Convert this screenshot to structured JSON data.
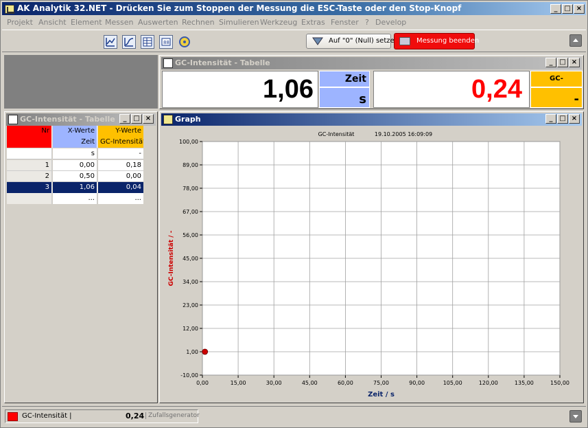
{
  "window": {
    "title": "AK Analytik 32.NET - Drücken Sie zum Stoppen der Messung die ESC-Taste oder den Stop-Knopf"
  },
  "menu": [
    "Projekt",
    "Ansicht",
    "Element",
    "Messen",
    "Auswerten",
    "Rechnen",
    "Simulieren",
    "Werkzeug",
    "Extras",
    "Fenster",
    "?",
    "Develop"
  ],
  "toolbar": {
    "zero_button": "Auf \"0\" (Null) setzen",
    "stop_button": "Messung beenden"
  },
  "value_panel": {
    "title": "GC-Intensität - Tabelle",
    "time_value": "1,06",
    "time_label": "Zeit",
    "time_unit": "s",
    "intensity_value": "0,24",
    "intensity_label": "GC-Intensität",
    "intensity_unit": "-"
  },
  "table_panel": {
    "title": "GC-Intensität - Tabelle",
    "headers": [
      "Nr",
      "X-Werte",
      "Y-Werte"
    ],
    "names": [
      "",
      "Zeit",
      "GC-Intensität"
    ],
    "units": [
      "",
      "s",
      "-"
    ],
    "rows": [
      [
        "1",
        "0,00",
        "0,18"
      ],
      [
        "2",
        "0,50",
        "0,00"
      ],
      [
        "3",
        "1,06",
        "0,04"
      ]
    ],
    "ellipsis": "..."
  },
  "graph_panel": {
    "title": "Graph"
  },
  "chart_data": {
    "type": "scatter",
    "title": "GC-Intensität",
    "timestamp": "19.10.2005 16:09:09",
    "xlabel": "Zeit / s",
    "ylabel": "GC-Intensität / -",
    "xlim": [
      0,
      150
    ],
    "ylim": [
      -10,
      100
    ],
    "x_ticks": [
      "0,00",
      "15,00",
      "30,00",
      "45,00",
      "60,00",
      "75,00",
      "90,00",
      "105,00",
      "120,00",
      "135,00",
      "150,00"
    ],
    "y_ticks": [
      "-10,00",
      "1,00",
      "12,00",
      "23,00",
      "34,00",
      "45,00",
      "56,00",
      "67,00",
      "78,00",
      "89,00",
      "100,00"
    ],
    "grid": true,
    "series": [
      {
        "points": [
          [
            1.06,
            1.0
          ]
        ],
        "color": "#cc0000"
      }
    ]
  },
  "status": {
    "channel": "GC-Intensität |",
    "value": "0,24",
    "source": "Zufallsgenerator"
  },
  "colors": {
    "accent_red": "#ff0000",
    "x_header": "#9db4ff",
    "y_header": "#ffc000",
    "selection": "#0a246a"
  }
}
